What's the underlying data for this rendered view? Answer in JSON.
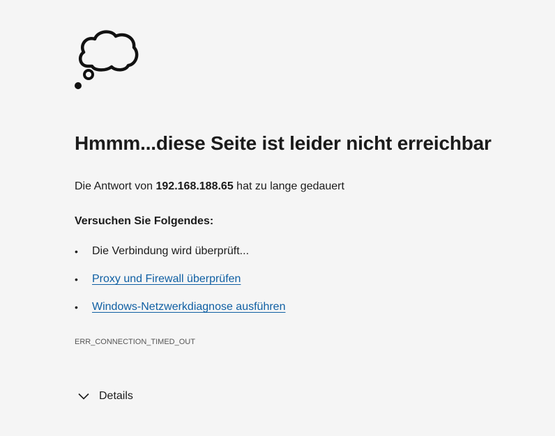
{
  "error": {
    "icon": "thought-cloud-icon",
    "heading": "Hmmm...diese Seite ist leider nicht erreichbar",
    "summary_prefix": "Die Antwort von ",
    "host": "192.168.188.65",
    "summary_suffix": " hat zu lange gedauert",
    "suggestions_title": "Versuchen Sie Folgendes:",
    "suggestions": [
      {
        "text": "Die Verbindung wird überprüft..."
      },
      {
        "text": "Proxy und Firewall überprüfen"
      },
      {
        "text": "Windows-Netzwerkdiagnose ausführen"
      }
    ],
    "bullet": "•",
    "code": "ERR_CONNECTION_TIMED_OUT",
    "details_label": "Details",
    "link_color": "#0f5fa3"
  }
}
